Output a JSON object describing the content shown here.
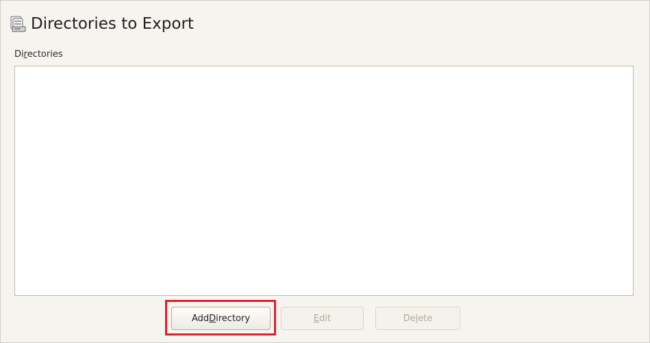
{
  "header": {
    "title": "Directories to Export",
    "icon": "nfs-server-icon"
  },
  "section": {
    "label_prefix": "Di",
    "label_mnemonic": "r",
    "label_suffix": "ectories"
  },
  "directories_list": {
    "items": []
  },
  "buttons": {
    "add": {
      "prefix": "Add ",
      "mnemonic": "D",
      "suffix": "irectory",
      "enabled": true
    },
    "edit": {
      "prefix": "",
      "mnemonic": "E",
      "suffix": "dit",
      "enabled": false
    },
    "delete": {
      "prefix": "De",
      "mnemonic": "l",
      "suffix": "ete",
      "enabled": false
    }
  },
  "colors": {
    "highlight": "#e01f2c",
    "panel_background": "#f6f4ef",
    "list_border": "#c6b79e"
  }
}
